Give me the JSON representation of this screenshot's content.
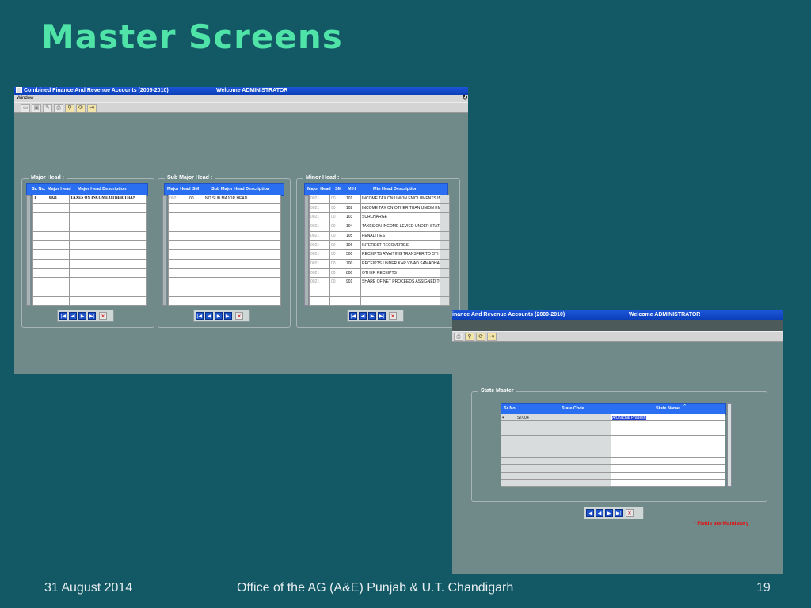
{
  "slide": {
    "title": "Master Screens",
    "footer_date": "31 August 2014",
    "footer_office": "Office of the AG (A&E) Punjab & U.T. Chandigarh",
    "page_number": "19"
  },
  "window1": {
    "title": "Combined Finance And Revenue Accounts (2009-2010)",
    "welcome": "Welcome  ADMINISTRATOR",
    "menu": "Window",
    "major_head": {
      "panel_title": "Major Head :",
      "columns": [
        "Sr. No.",
        "Major Head",
        "Major Head Description"
      ],
      "rows": [
        [
          "1",
          "0021",
          "TAXES ON INCOME OTHER THAN"
        ]
      ]
    },
    "sub_major_head": {
      "panel_title": "Sub Major Head :",
      "columns": [
        "Major Head",
        "SM",
        "Sub Major Head Description"
      ],
      "rows": [
        [
          "0021",
          "00",
          "NO SUB MAJOR HEAD"
        ]
      ]
    },
    "minor_head": {
      "panel_title": "Minor Head :",
      "columns": [
        "Major Head",
        "SM",
        "MIH",
        "Min Head Description"
      ],
      "rows": [
        [
          "0021",
          "00",
          "101",
          "INCOME TAX ON UNION EMOLUMENTS IN"
        ],
        [
          "0021",
          "00",
          "102",
          "INCOME TAX ON OTHER THAN UNION EM"
        ],
        [
          "0021",
          "00",
          "103",
          "SURCHARGE"
        ],
        [
          "0021",
          "00",
          "104",
          "TAXES ON INCOME LEVIED UNDER STATE"
        ],
        [
          "0021",
          "00",
          "105",
          "PENALITIES"
        ],
        [
          "0021",
          "00",
          "106",
          "INTEREST RECOVERIES"
        ],
        [
          "0021",
          "00",
          "500",
          "RECEIPTS AWAITING TRANSFER TO OTHE"
        ],
        [
          "0021",
          "00",
          "700",
          "RECEIPTS UNDER KAR VIVAD SAMADHA"
        ],
        [
          "0021",
          "00",
          "800",
          "OTHER RECEIPTS"
        ],
        [
          "0021",
          "00",
          "901",
          "SHARE OF NET PROCEEDS ASSIGNED TO"
        ]
      ]
    }
  },
  "window2": {
    "title": "inance And Revenue Accounts (2009-2010)",
    "welcome": "Welcome  ADMINISTRATOR",
    "state_master": {
      "panel_title": "State Master",
      "columns": [
        "Sr No.",
        "State Code",
        "State Name"
      ],
      "sort_marker": "^",
      "rows": [
        [
          "4",
          "ST004",
          "Arunachal Pradesh"
        ]
      ]
    },
    "mandatory_note": "* Fields are Mandatory"
  },
  "icons": {
    "nav": [
      "first-record-icon",
      "previous-record-icon",
      "next-record-icon",
      "last-record-icon",
      "delete-record-icon"
    ],
    "nav_glyphs": [
      "|◀",
      "◀",
      "▶",
      "▶|",
      "✕"
    ]
  },
  "colors": {
    "slide_bg": "#135865",
    "title_green": "#4fe3a7",
    "window_bg": "#6f8a89",
    "titlebar_blue": "#0b3fb8",
    "grid_header_blue": "#2a6ff2",
    "mandatory_red": "#e01010"
  }
}
